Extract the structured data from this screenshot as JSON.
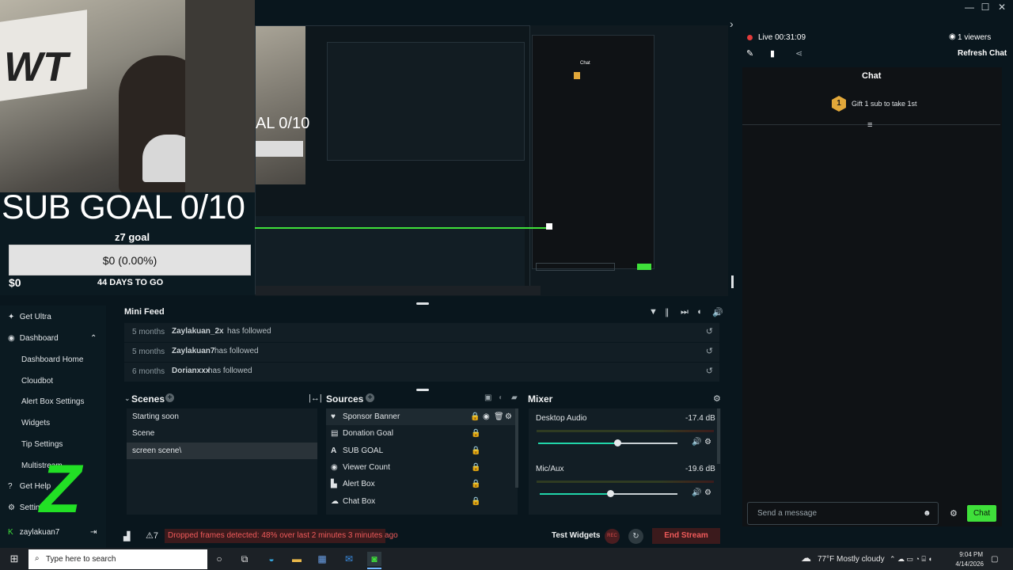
{
  "window": {
    "minimize": "—",
    "maximize": "☐",
    "close": "✕"
  },
  "goal_overlay": {
    "title": "SUB GOAL 0/10",
    "label": "z7 goal",
    "bar_text": "$0 (0.00%)",
    "current": "$0",
    "days_left": "44 DAYS TO GO"
  },
  "sidebar": {
    "get_ultra": "Get Ultra",
    "dashboard": "Dashboard",
    "items": [
      "Dashboard Home",
      "Cloudbot",
      "Alert Box Settings",
      "Widgets",
      "Tip Settings",
      "Multistream"
    ],
    "get_help": "Get Help",
    "settings": "Settings",
    "user": "zaylakuan7",
    "logo": "Z"
  },
  "mini_feed": {
    "title": "Mini Feed",
    "rows": [
      {
        "time": "5 months",
        "name": "Zaylakuan_2x",
        "action": "has followed"
      },
      {
        "time": "5 months",
        "name": "Zaylakuan7",
        "action": "has followed"
      },
      {
        "time": "6 months",
        "name": "Dorianxxx",
        "action": "has followed"
      }
    ]
  },
  "scenes": {
    "title": "Scenes",
    "items": [
      "Starting soon",
      "Scene",
      "screen scene\\"
    ],
    "selected": 2
  },
  "sources": {
    "title": "Sources",
    "items": [
      {
        "icon": "heart-icon",
        "name": "Sponsor Banner"
      },
      {
        "icon": "donation-icon",
        "name": "Donation Goal"
      },
      {
        "icon": "text-icon",
        "name": "SUB GOAL"
      },
      {
        "icon": "eye-icon",
        "name": "Viewer Count"
      },
      {
        "icon": "alert-icon",
        "name": "Alert Box"
      },
      {
        "icon": "chat-icon",
        "name": "Chat Box"
      }
    ]
  },
  "mixer": {
    "title": "Mixer",
    "channels": [
      {
        "name": "Desktop Audio",
        "db": "-17.4 dB",
        "level": 0.57
      },
      {
        "name": "Mic/Aux",
        "db": "-19.6 dB",
        "level": 0.51
      }
    ]
  },
  "status": {
    "alert_count": "7",
    "dropped_frames": "Dropped frames detected: 48% over last 2 minutes 3 minutes ago",
    "test_widgets": "Test Widgets",
    "rec": "REC",
    "end_stream": "End Stream"
  },
  "chat": {
    "live": "Live 00:31:09",
    "viewers": "1 viewers",
    "refresh": "Refresh Chat",
    "title": "Chat",
    "gift_badge": "1",
    "gift_text": "Gift 1 sub to take 1st",
    "placeholder": "Send a message",
    "send": "Chat"
  },
  "taskbar": {
    "search_placeholder": "Type here to search",
    "weather": "77°F  Mostly cloudy",
    "time": "9:04 PM",
    "date": "4/14/2026"
  }
}
